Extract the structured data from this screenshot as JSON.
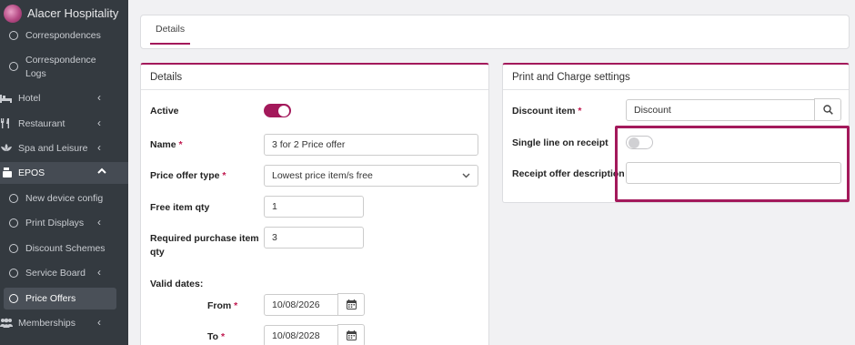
{
  "brand": {
    "name": "Alacer Hospitality"
  },
  "sidebar": {
    "items": [
      {
        "label": "Correspondences"
      },
      {
        "label": "Correspondence",
        "label2": "Logs"
      },
      {
        "label": "Hotel"
      },
      {
        "label": "Restaurant"
      },
      {
        "label": "Spa and Leisure"
      },
      {
        "label": "EPOS"
      },
      {
        "label": "New device config"
      },
      {
        "label": "Print Displays"
      },
      {
        "label": "Discount Schemes"
      },
      {
        "label": "Service Board"
      },
      {
        "label": "Price Offers"
      },
      {
        "label": "Memberships"
      }
    ]
  },
  "tabs": [
    {
      "label": "Details"
    }
  ],
  "details": {
    "title": "Details",
    "active_label": "Active",
    "active_value": true,
    "name_label": "Name",
    "name_value": "3 for 2 Price offer",
    "type_label": "Price offer type",
    "type_value": "Lowest price item/s free",
    "free_qty_label": "Free item qty",
    "free_qty_value": "1",
    "req_qty_label": "Required purchase item",
    "req_qty_label2": "qty",
    "req_qty_value": "3",
    "valid_dates_label": "Valid dates:",
    "from_label": "From",
    "from_value": "10/08/2026",
    "to_label": "To",
    "to_value": "10/08/2028",
    "required_mark": "*"
  },
  "print": {
    "title": "Print and Charge settings",
    "discount_label": "Discount item",
    "discount_value": "Discount",
    "single_line_label": "Single line on receipt",
    "single_line_value": false,
    "receipt_desc_label": "Receipt offer description",
    "receipt_desc_value": "",
    "required_mark": "*"
  },
  "colors": {
    "accent": "#a3195b",
    "sidebar": "#343a40"
  }
}
